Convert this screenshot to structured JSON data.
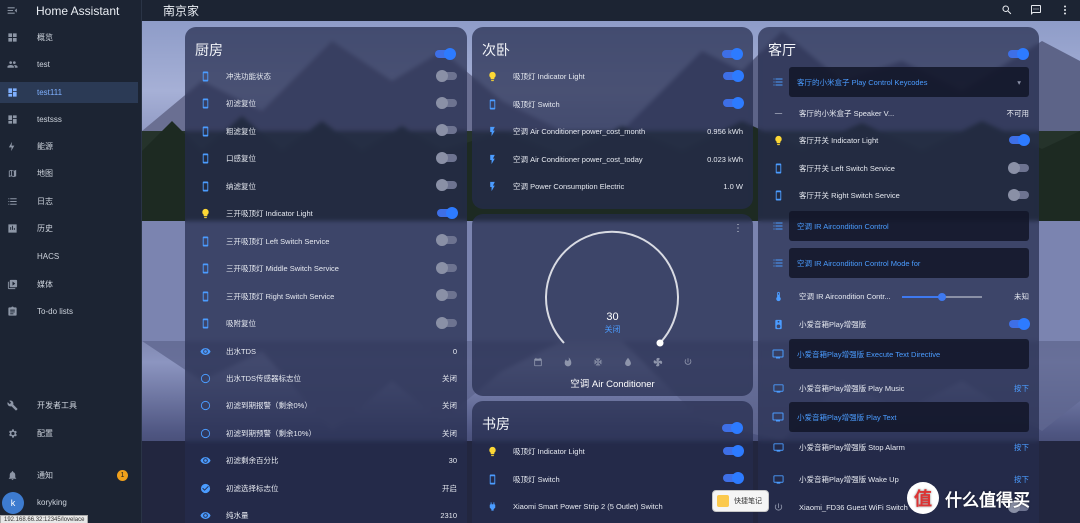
{
  "app_title": "Home Assistant",
  "page_title": "南京家",
  "sidebar": {
    "items": [
      {
        "label": "概览",
        "icon": "grid-icon"
      },
      {
        "label": "test",
        "icon": "people-icon"
      },
      {
        "label": "test111",
        "icon": "dashboard-icon",
        "active": true
      },
      {
        "label": "testsss",
        "icon": "dashboard-icon"
      },
      {
        "label": "能源",
        "icon": "lightning-icon"
      },
      {
        "label": "地图",
        "icon": "map-icon"
      },
      {
        "label": "日志",
        "icon": "list-icon"
      },
      {
        "label": "历史",
        "icon": "chart-icon"
      },
      {
        "label": "HACS",
        "icon": "hacs-icon"
      },
      {
        "label": "媒体",
        "icon": "media-icon"
      },
      {
        "label": "To-do lists",
        "icon": "todo-icon"
      }
    ],
    "bottom": [
      {
        "label": "开发者工具",
        "icon": "wrench-icon"
      },
      {
        "label": "配置",
        "icon": "gear-icon"
      }
    ],
    "notifications_label": "通知",
    "notifications_count": "1",
    "user_name": "koryking",
    "user_initial": "k"
  },
  "status_url": "192.168.66.32:12345/lovelace",
  "kitchen": {
    "title": "厨房",
    "rows": [
      {
        "label": "冲洗功能状态",
        "value": "",
        "type": "toggle",
        "on": false,
        "icon": "phone-icon"
      },
      {
        "label": "初滤复位",
        "value": "",
        "type": "toggle",
        "on": false,
        "icon": "phone-icon"
      },
      {
        "label": "粗滤复位",
        "value": "",
        "type": "toggle",
        "on": false,
        "icon": "phone-icon"
      },
      {
        "label": "口感复位",
        "value": "",
        "type": "toggle",
        "on": false,
        "icon": "phone-icon"
      },
      {
        "label": "纳滤复位",
        "value": "",
        "type": "toggle",
        "on": false,
        "icon": "phone-icon"
      },
      {
        "label": "三开吸顶灯 Indicator Light",
        "value": "",
        "type": "toggle",
        "on": true,
        "icon": "bulb-icon"
      },
      {
        "label": "三开吸顶灯 Left Switch Service",
        "value": "",
        "type": "toggle",
        "on": false,
        "icon": "phone-icon"
      },
      {
        "label": "三开吸顶灯 Middle Switch Service",
        "value": "",
        "type": "toggle",
        "on": false,
        "icon": "phone-icon"
      },
      {
        "label": "三开吸顶灯 Right Switch Service",
        "value": "",
        "type": "toggle",
        "on": false,
        "icon": "phone-icon"
      },
      {
        "label": "吸附复位",
        "value": "",
        "type": "toggle",
        "on": false,
        "icon": "phone-icon"
      },
      {
        "label": "出水TDS",
        "value": "0",
        "type": "text",
        "icon": "eye-icon"
      },
      {
        "label": "出水TDS传感器标志位",
        "value": "关闭",
        "type": "text",
        "icon": "circle-icon"
      },
      {
        "label": "初滤到期报警（剩余0%）",
        "value": "关闭",
        "type": "text",
        "icon": "circle-icon"
      },
      {
        "label": "初滤到期预警（剩余10%）",
        "value": "关闭",
        "type": "text",
        "icon": "circle-icon"
      },
      {
        "label": "初滤剩余百分比",
        "value": "30",
        "type": "text",
        "icon": "eye-icon"
      },
      {
        "label": "初滤选择标志位",
        "value": "开启",
        "type": "text",
        "icon": "check-circle-icon"
      },
      {
        "label": "纯水量",
        "value": "2310",
        "type": "text",
        "icon": "eye-icon"
      }
    ]
  },
  "bedroom": {
    "title": "次卧",
    "rows": [
      {
        "label": "吸顶灯 Indicator Light",
        "value": "",
        "type": "toggle",
        "on": true,
        "icon": "bulb-icon"
      },
      {
        "label": "吸顶灯 Switch",
        "value": "",
        "type": "toggle",
        "on": true,
        "icon": "phone-icon"
      },
      {
        "label": "空调 Air Conditioner power_cost_month",
        "value": "0.956 kWh",
        "type": "text",
        "icon": "flash-icon"
      },
      {
        "label": "空调 Air Conditioner power_cost_today",
        "value": "0.023 kWh",
        "type": "text",
        "icon": "flash-icon"
      },
      {
        "label": "空调 Power Consumption Electric",
        "value": "1.0 W",
        "type": "text",
        "icon": "flash-icon"
      }
    ]
  },
  "thermostat": {
    "temp": "30",
    "state": "关闭",
    "name": "空调 Air Conditioner",
    "modes": [
      "calendar-icon",
      "fire-icon",
      "snowflake-icon",
      "drop-icon",
      "fan-icon",
      "power-icon"
    ]
  },
  "study": {
    "title": "书房",
    "rows": [
      {
        "label": "吸顶灯 Indicator Light",
        "value": "",
        "type": "toggle",
        "on": true,
        "icon": "bulb-icon"
      },
      {
        "label": "吸顶灯 Switch",
        "value": "",
        "type": "toggle",
        "on": true,
        "icon": "phone-icon"
      },
      {
        "label": "Xiaomi Smart Power Strip 2 (5 Outlet) Switch",
        "value": "",
        "type": "toggle",
        "on": true,
        "icon": "plug-icon"
      }
    ]
  },
  "living": {
    "title": "客厅",
    "rows": [
      {
        "label": "客厅的小米盒子 Play Control Keycodes",
        "kind": "sub",
        "icon": "list-icon"
      },
      {
        "label": "客厅的小米盒子 Speaker V...",
        "value": "不可用",
        "kind": "row",
        "icon": "minus-icon"
      },
      {
        "label": "客厅开关 Indicator Light",
        "kind": "toggle",
        "on": true,
        "icon": "bulb-icon"
      },
      {
        "label": "客厅开关 Left Switch Service",
        "kind": "toggle",
        "on": false,
        "icon": "phone-icon"
      },
      {
        "label": "客厅开关 Right Switch Service",
        "kind": "toggle",
        "on": false,
        "icon": "phone-icon"
      },
      {
        "label": "空调 IR Aircondition Control",
        "kind": "sub",
        "icon": "list-icon"
      },
      {
        "label": "空调 IR Aircondition Control Mode for",
        "kind": "sub",
        "icon": "list-icon"
      },
      {
        "label": "空调 IR Aircondition Contr...",
        "value": "未知",
        "kind": "slider",
        "level": 0.5,
        "icon": "thermometer-icon"
      },
      {
        "label": "小爱音箱Play增强版",
        "kind": "toggle",
        "on": true,
        "icon": "speaker-icon"
      },
      {
        "label": "小爱音箱Play增强版 Execute Text Directive",
        "kind": "sub",
        "icon": "monitor-icon"
      },
      {
        "label": "小爱音箱Play增强版 Play Music",
        "value": "按下",
        "kind": "link",
        "icon": "monitor-icon"
      },
      {
        "label": "小爱音箱Play增强版 Play Text",
        "kind": "sub",
        "icon": "monitor-icon"
      },
      {
        "label": "小爱音箱Play增强版 Stop Alarm",
        "value": "按下",
        "kind": "link",
        "icon": "monitor-icon"
      },
      {
        "label": "小爱音箱Play增强版 Wake Up",
        "value": "按下",
        "kind": "link",
        "icon": "monitor-icon"
      },
      {
        "label": "Xiaomi_FD36 Guest WiFi Switch",
        "kind": "toggle",
        "on": false,
        "icon": "power-icon"
      }
    ]
  },
  "toast": "快捷笔记",
  "watermark": "什么值得买",
  "colors": {
    "accent": "#3e79f0",
    "link": "#4b9cff",
    "badge": "#f0a01b",
    "sidebar": "#1c2433"
  }
}
